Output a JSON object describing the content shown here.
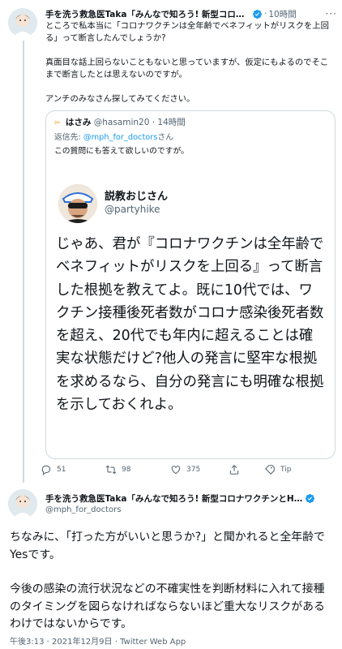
{
  "tweet1": {
    "author_name": "手を洗う救急医Taka「みんなで知ろう! 新型コロナワク…",
    "time": "10時間",
    "paragraphs": [
      "ところで私本当に「コロナワクチンは全年齢でベネフィットがリスクを上回る」って断言したんでしょうか?",
      "真面目な話上回らないこともないと思っていますが、仮定にもよるのでそこまで断言したとは思えないのですが。",
      "アンチのみなさん探してみてください。"
    ]
  },
  "quote": {
    "name": "はさみ",
    "handle": "@hasamin20",
    "time": "14時間",
    "reply_prefix": "返信先: ",
    "reply_mention": "@mph_for_doctors",
    "reply_suffix": "さん",
    "text": "この質問にも答えて欲しいのですが。",
    "image": {
      "name": "説教おじさん",
      "handle": "@partyhike",
      "text": "じゃあ、君が『コロナワクチンは全年齢でベネフィットがリスクを上回る』って断言した根拠を教えてよ。既に10代では、ワクチン接種後死者数がコロナ感染後死者数を超え、20代でも年内に超えることは確実な状態だけど?他人の発言に堅牢な根拠を求めるなら、自分の発言にも明確な根拠を示しておくれよ。"
    }
  },
  "actions": {
    "reply_count": "51",
    "retweet_count": "98",
    "like_count": "375",
    "tip_label": "Tip"
  },
  "tweet2": {
    "author_name": "手を洗う救急医Taka「みんなで知ろう! 新型コロナワクチンとH…",
    "handle": "@mph_for_doctors",
    "paragraphs": [
      "ちなみに、「打った方がいいと思うか?」と聞かれると全年齢でYesです。",
      "今後の感染の流行状況などの不確実性を判断材料に入れて接種のタイミングを図らなければならないほど重大なリスクがあるわけではないからです。"
    ],
    "footer": "午後3:13 · 2021年12月9日 · Twitter Web App"
  },
  "colors": {
    "accent": "#1d9bf0",
    "text": "#0f1419",
    "muted": "#536471",
    "border": "#cfd9de"
  },
  "icons": [
    "verified-badge-icon",
    "more-icon",
    "reply-icon",
    "retweet-icon",
    "like-icon",
    "share-icon",
    "tip-icon"
  ]
}
